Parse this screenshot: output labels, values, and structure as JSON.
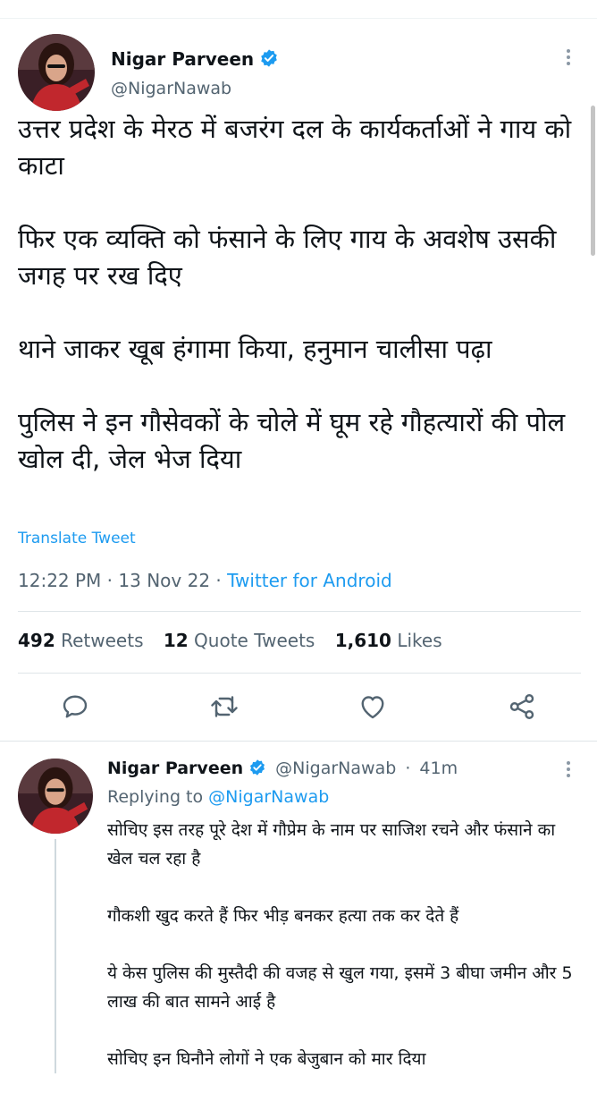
{
  "tweet": {
    "author_name": "Nigar Parveen",
    "author_handle": "@NigarNawab",
    "paragraphs": [
      "उत्तर प्रदेश के मेरठ में बजरंग दल के कार्यकर्ताओं ने गाय को काटा",
      "फिर एक व्यक्ति को फंसाने के लिए गाय के अवशेष उसकी जगह पर रख दिए",
      "थाने जाकर खूब हंगामा किया, हनुमान चालीसा पढ़ा",
      "पुलिस ने इन गौसेवकों के चोले में घूम रहे गौहत्यारों की पोल खोल दी, जेल भेज दिया"
    ],
    "translate_label": "Translate Tweet",
    "time": "12:22 PM",
    "date": "13 Nov 22",
    "source": "Twitter for Android",
    "retweets_count": "492",
    "retweets_label": "Retweets",
    "quotes_count": "12",
    "quotes_label": "Quote Tweets",
    "likes_count": "1,610",
    "likes_label": "Likes"
  },
  "reply": {
    "author_name": "Nigar Parveen",
    "author_handle": "@NigarNawab",
    "age": "41m",
    "replying_prefix": "Replying to",
    "replying_handle": "@NigarNawab",
    "paragraphs": [
      "सोचिए इस तरह पूरे देश में गौप्रेम के नाम पर साजिश रचने और फंसाने का खेल चल रहा है",
      "गौकशी खुद करते हैं फिर भीड़ बनकर हत्या तक कर देते हैं",
      "ये केस पुलिस की मुस्तैदी की वजह से खुल गया, इसमें 3 बीघा जमीन और 5 लाख की बात सामने आई है",
      "सोचिए इन घिनौने लोगों ने एक बेजुबान को मार दिया"
    ]
  },
  "icons": {
    "verified": "verified-badge-icon",
    "more": "more-vertical-icon",
    "reply": "reply-icon",
    "retweet": "retweet-icon",
    "like": "like-icon",
    "share": "share-icon"
  },
  "colors": {
    "accent": "#1d9bf0",
    "text": "#0f1419",
    "secondary": "#536471",
    "divider": "#dfe5e8"
  }
}
